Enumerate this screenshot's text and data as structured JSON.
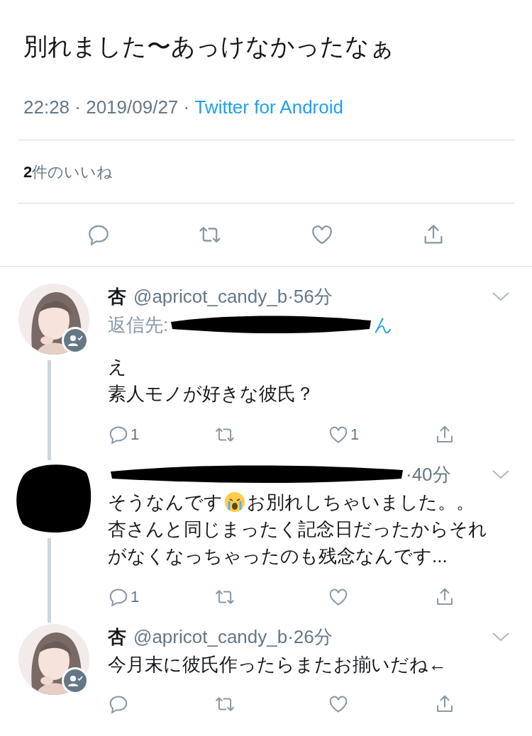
{
  "tweet": {
    "text": "別れました〜あっけなかったなぁ",
    "time": "22:28 · 2019/09/27 · ",
    "source": "Twitter for Android",
    "likes_summary": "**2**件のいいね"
  },
  "replies": [
    {
      "kind": "picture",
      "name": "杏",
      "handle": "@apricot_candy_b",
      "time": "·56分",
      "verified_badge": true,
      "reply_to": "返信先:",
      "reply_to_tail": "ん",
      "lines": [
        [
          {
            "kind": "text",
            "text": "え"
          }
        ],
        [
          {
            "kind": "text",
            "text": "素人モノが好きな彼氏？"
          }
        ]
      ],
      "reply_count": "1",
      "like_count": "1",
      "thread_below": true
    },
    {
      "kind": "redacted",
      "time": "·40分",
      "verified_badge": false,
      "lines": [
        [
          {
            "kind": "text",
            "text": "そうなんです"
          },
          {
            "kind": "crying-emoji"
          },
          {
            "kind": "text",
            "text": "お別れしちゃいました。。"
          }
        ],
        [
          {
            "kind": "text",
            "text": "杏さんと同じまったく記念日だったからそれ"
          }
        ],
        [
          {
            "kind": "text",
            "text": "がなくなっちゃったのも残念なんです..."
          }
        ]
      ],
      "reply_count": "1",
      "thread_below": true
    },
    {
      "kind": "picture",
      "name": "杏",
      "handle": "@apricot_candy_b",
      "time": "·26分",
      "verified_badge": true,
      "lines": [
        [
          {
            "kind": "text",
            "text": "今月末に彼氏作ったらまたお揃いだね←"
          }
        ]
      ],
      "thread_below": false
    }
  ]
}
